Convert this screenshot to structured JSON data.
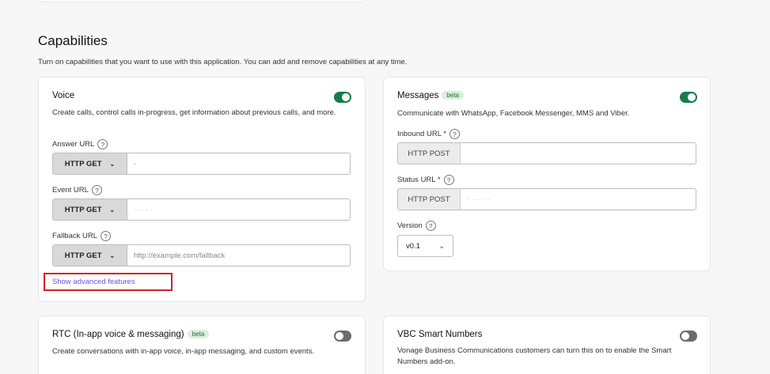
{
  "section": {
    "title": "Capabilities",
    "description": "Turn on capabilities that you want to use with this application. You can add and remove capabilities at any time."
  },
  "voice": {
    "title": "Voice",
    "enabled": true,
    "description": "Create calls, control calls in-progress, get information about previous calls, and more.",
    "answer_url": {
      "label": "Answer URL",
      "method": "HTTP GET",
      "value": "·"
    },
    "event_url": {
      "label": "Event URL",
      "method": "HTTP GET",
      "value": "·· · · ·"
    },
    "fallback_url": {
      "label": "Fallback URL",
      "method": "HTTP GET",
      "placeholder": "http://example.com/fallback"
    },
    "advanced_link": "Show advanced features"
  },
  "messages": {
    "title": "Messages",
    "badge": "beta",
    "enabled": true,
    "description": "Communicate with WhatsApp, Facebook Messenger, MMS and Viber.",
    "inbound_url": {
      "label": "Inbound URL *",
      "method": "HTTP POST",
      "value": ""
    },
    "status_url": {
      "label": "Status URL *",
      "method": "HTTP POST",
      "value": "· ·· · · ·"
    },
    "version": {
      "label": "Version",
      "selected": "v0.1"
    }
  },
  "rtc": {
    "title": "RTC (In-app voice & messaging)",
    "badge": "beta",
    "enabled": false,
    "description": "Create conversations with in-app voice, in-app messaging, and custom events."
  },
  "vbc": {
    "title": "VBC Smart Numbers",
    "enabled": false,
    "description": "Vonage Business Communications customers can turn this on to enable the Smart Numbers add-on."
  },
  "colors": {
    "toggle_on": "#197a4b",
    "toggle_off": "#6b6b6b",
    "link": "#6b4fe0",
    "highlight_box": "#d81f26"
  }
}
